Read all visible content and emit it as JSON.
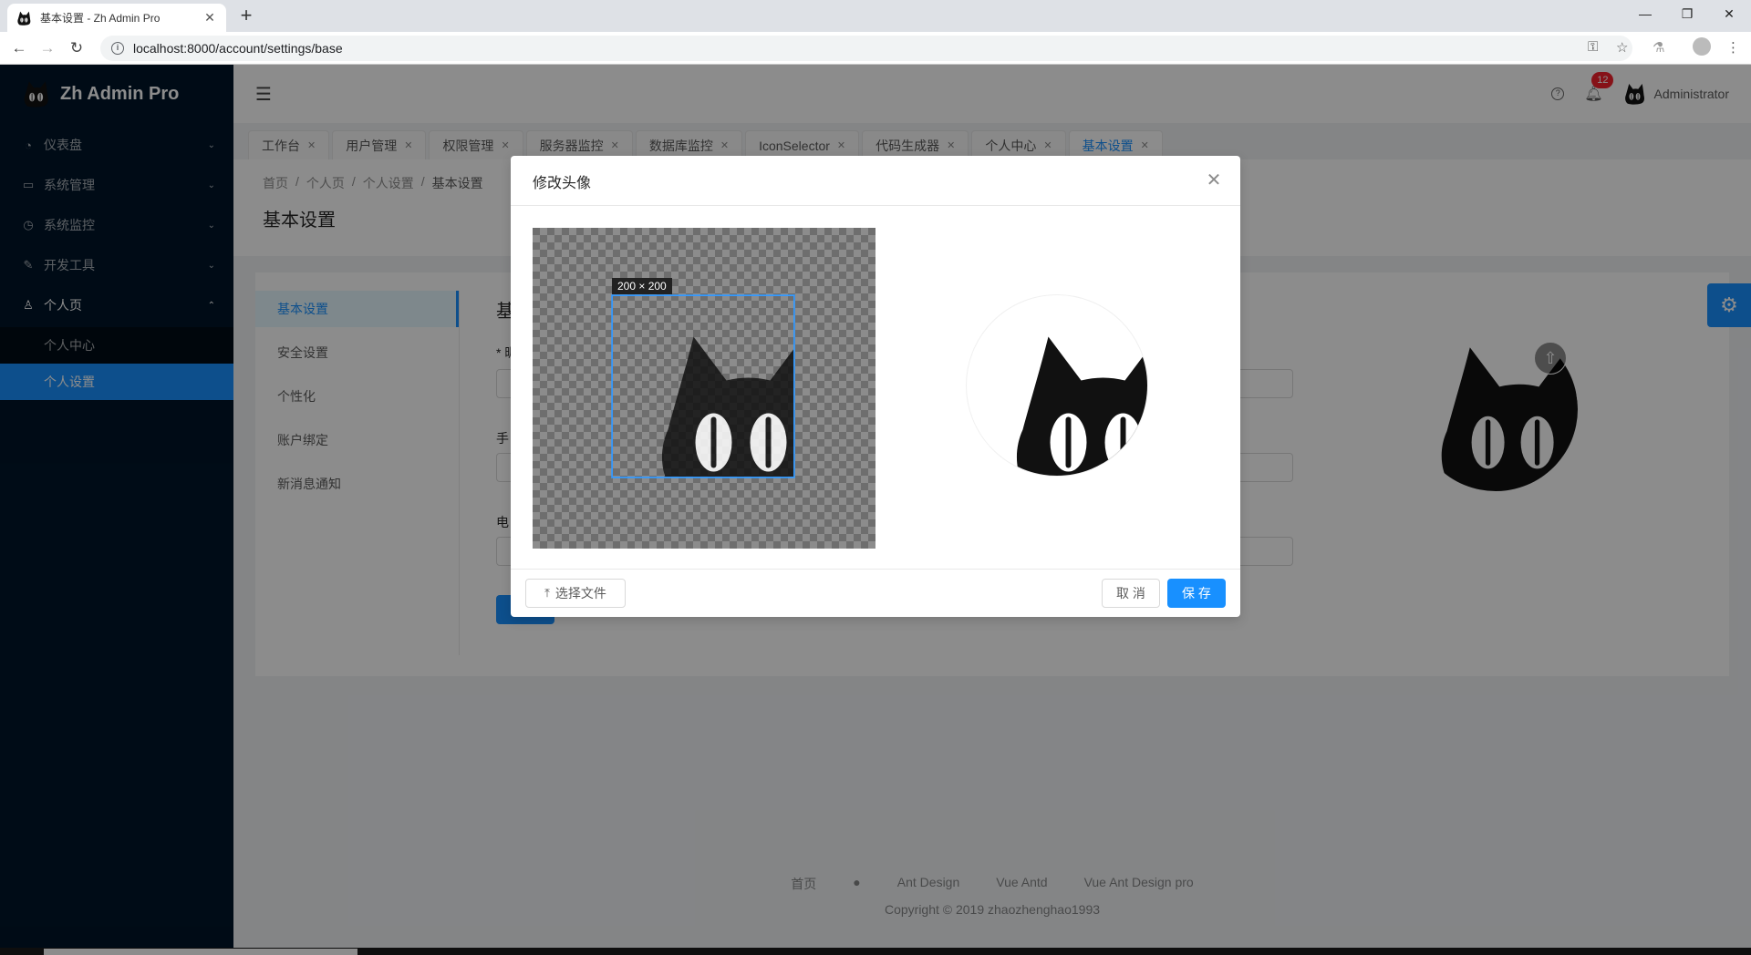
{
  "browser": {
    "tab_title": "基本设置 - Zh Admin Pro",
    "url": "localhost:8000/account/settings/base"
  },
  "app": {
    "name": "Zh Admin Pro"
  },
  "sidebar": {
    "items": [
      {
        "label": "仪表盘",
        "icon": "dashboard-icon"
      },
      {
        "label": "系统管理",
        "icon": "desktop-icon"
      },
      {
        "label": "系统监控",
        "icon": "fund-icon"
      },
      {
        "label": "开发工具",
        "icon": "tool-icon"
      },
      {
        "label": "个人页",
        "icon": "user-icon"
      }
    ],
    "subitems": [
      {
        "label": "个人中心"
      },
      {
        "label": "个人设置",
        "selected": true
      }
    ]
  },
  "header": {
    "notification_count": "12",
    "username": "Administrator"
  },
  "page_tabs": [
    {
      "label": "工作台"
    },
    {
      "label": "用户管理"
    },
    {
      "label": "权限管理"
    },
    {
      "label": "服务器监控"
    },
    {
      "label": "数据库监控"
    },
    {
      "label": "IconSelector"
    },
    {
      "label": "代码生成器"
    },
    {
      "label": "个人中心"
    },
    {
      "label": "基本设置",
      "active": true
    }
  ],
  "breadcrumb": [
    "首页",
    "个人页",
    "个人设置",
    "基本设置"
  ],
  "page_title": "基本设置",
  "settings_menu": [
    {
      "label": "基本设置",
      "active": true
    },
    {
      "label": "安全设置"
    },
    {
      "label": "个性化"
    },
    {
      "label": "账户绑定"
    },
    {
      "label": "新消息通知"
    }
  ],
  "form": {
    "title_partial": "基",
    "label1_partial": "* 昵",
    "label2_partial": "手",
    "label3_partial": "电"
  },
  "modal": {
    "title": "修改头像",
    "crop_size": "200 × 200",
    "select_file": "选择文件",
    "cancel": "取 消",
    "save": "保 存"
  },
  "footer": {
    "links": [
      "首页",
      "Ant Design",
      "Vue Antd",
      "Vue Ant Design pro"
    ],
    "copyright": "Copyright © 2019 zhaozhenghao1993"
  },
  "colors": {
    "primary": "#1890ff",
    "sider": "#001529",
    "badge": "#f5222d"
  }
}
